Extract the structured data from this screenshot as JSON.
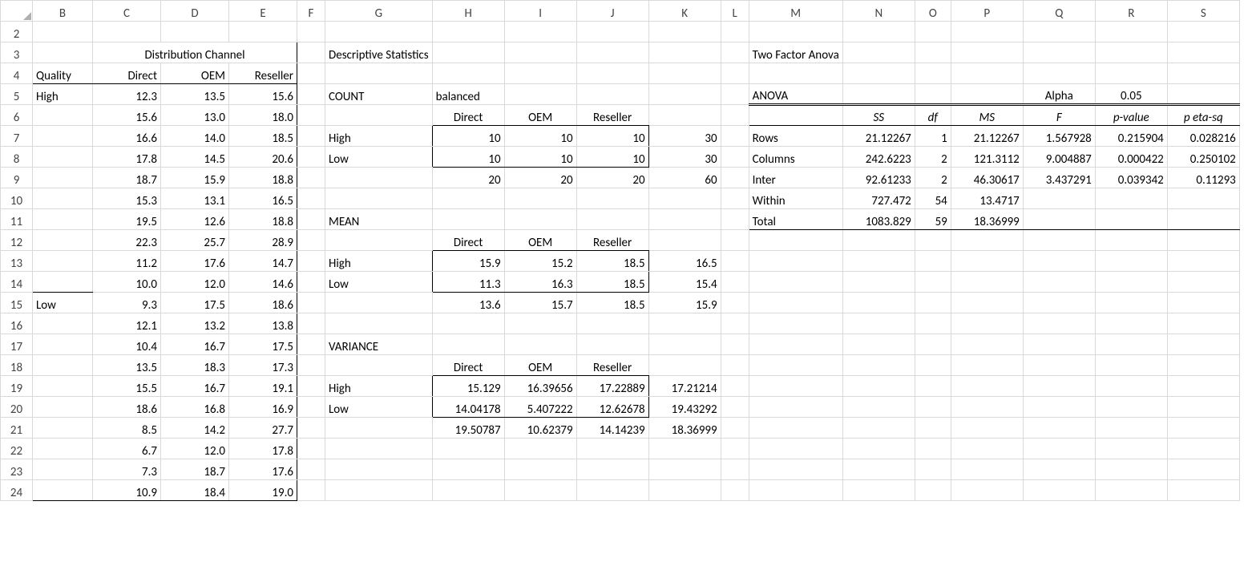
{
  "columns": [
    "B",
    "C",
    "D",
    "E",
    "F",
    "G",
    "H",
    "I",
    "J",
    "K",
    "L",
    "M",
    "N",
    "O",
    "P",
    "Q",
    "R",
    "S"
  ],
  "rows": [
    "2",
    "3",
    "4",
    "5",
    "6",
    "7",
    "8",
    "9",
    "10",
    "11",
    "12",
    "13",
    "14",
    "15",
    "16",
    "17",
    "18",
    "19",
    "20",
    "21",
    "22",
    "23",
    "24"
  ],
  "distribution": {
    "header_title": "Distribution Channel",
    "quality_label": "Quality",
    "col_labels": {
      "direct": "Direct",
      "oem": "OEM",
      "reseller": "Reseller"
    },
    "quality_values": {
      "high": "High",
      "low": "Low"
    },
    "high": {
      "direct": [
        "12.3",
        "15.6",
        "16.6",
        "17.8",
        "18.7",
        "15.3",
        "19.5",
        "22.3",
        "11.2",
        "10.0"
      ],
      "oem": [
        "13.5",
        "13.0",
        "14.0",
        "14.5",
        "15.9",
        "13.1",
        "12.6",
        "25.7",
        "17.6",
        "12.0"
      ],
      "reseller": [
        "15.6",
        "18.0",
        "18.5",
        "20.6",
        "18.8",
        "16.5",
        "18.8",
        "28.9",
        "14.7",
        "14.6"
      ]
    },
    "low": {
      "direct": [
        "9.3",
        "12.1",
        "10.4",
        "13.5",
        "15.5",
        "18.6",
        "8.5",
        "6.7",
        "7.3",
        "10.9"
      ],
      "oem": [
        "17.5",
        "13.2",
        "16.7",
        "18.3",
        "16.7",
        "16.8",
        "14.2",
        "12.0",
        "18.7",
        "18.4"
      ],
      "reseller": [
        "18.6",
        "13.8",
        "17.5",
        "17.3",
        "19.1",
        "16.9",
        "27.7",
        "17.8",
        "17.6",
        "19.0"
      ]
    }
  },
  "descriptive": {
    "title": "Descriptive Statistics",
    "count_label": "COUNT",
    "balanced_label": "balanced",
    "col_labels": {
      "direct": "Direct",
      "oem": "OEM",
      "reseller": "Reseller"
    },
    "row_labels": {
      "high": "High",
      "low": "Low"
    },
    "count": {
      "high": {
        "direct": "10",
        "oem": "10",
        "reseller": "10",
        "total": "30"
      },
      "low": {
        "direct": "10",
        "oem": "10",
        "reseller": "10",
        "total": "30"
      },
      "totals": {
        "direct": "20",
        "oem": "20",
        "reseller": "20",
        "total": "60"
      }
    },
    "mean_label": "MEAN",
    "mean": {
      "high": {
        "direct": "15.9",
        "oem": "15.2",
        "reseller": "18.5",
        "total": "16.5"
      },
      "low": {
        "direct": "11.3",
        "oem": "16.3",
        "reseller": "18.5",
        "total": "15.4"
      },
      "totals": {
        "direct": "13.6",
        "oem": "15.7",
        "reseller": "18.5",
        "total": "15.9"
      }
    },
    "variance_label": "VARIANCE",
    "variance": {
      "high": {
        "direct": "15.129",
        "oem": "16.39656",
        "reseller": "17.22889",
        "total": "17.21214"
      },
      "low": {
        "direct": "14.04178",
        "oem": "5.407222",
        "reseller": "12.62678",
        "total": "19.43292"
      },
      "totals": {
        "direct": "19.50787",
        "oem": "10.62379",
        "reseller": "14.14239",
        "total": "18.36999"
      }
    }
  },
  "anova": {
    "title": "Two Factor Anova",
    "anova_label": "ANOVA",
    "alpha_label": "Alpha",
    "alpha_value": "0.05",
    "headers": {
      "ss": "SS",
      "df": "df",
      "ms": "MS",
      "f": "F",
      "pvalue": "p-value",
      "petasq": "p eta-sq"
    },
    "rows": {
      "rows": {
        "label": "Rows",
        "ss": "21.12267",
        "df": "1",
        "ms": "21.12267",
        "f": "1.567928",
        "p": "0.215904",
        "eta": "0.028216"
      },
      "columns": {
        "label": "Columns",
        "ss": "242.6223",
        "df": "2",
        "ms": "121.3112",
        "f": "9.004887",
        "p": "0.000422",
        "eta": "0.250102"
      },
      "inter": {
        "label": "Inter",
        "ss": "92.61233",
        "df": "2",
        "ms": "46.30617",
        "f": "3.437291",
        "p": "0.039342",
        "eta": "0.11293"
      },
      "within": {
        "label": "Within",
        "ss": "727.472",
        "df": "54",
        "ms": "13.4717"
      },
      "total": {
        "label": "Total",
        "ss": "1083.829",
        "df": "59",
        "ms": "18.36999"
      }
    }
  }
}
